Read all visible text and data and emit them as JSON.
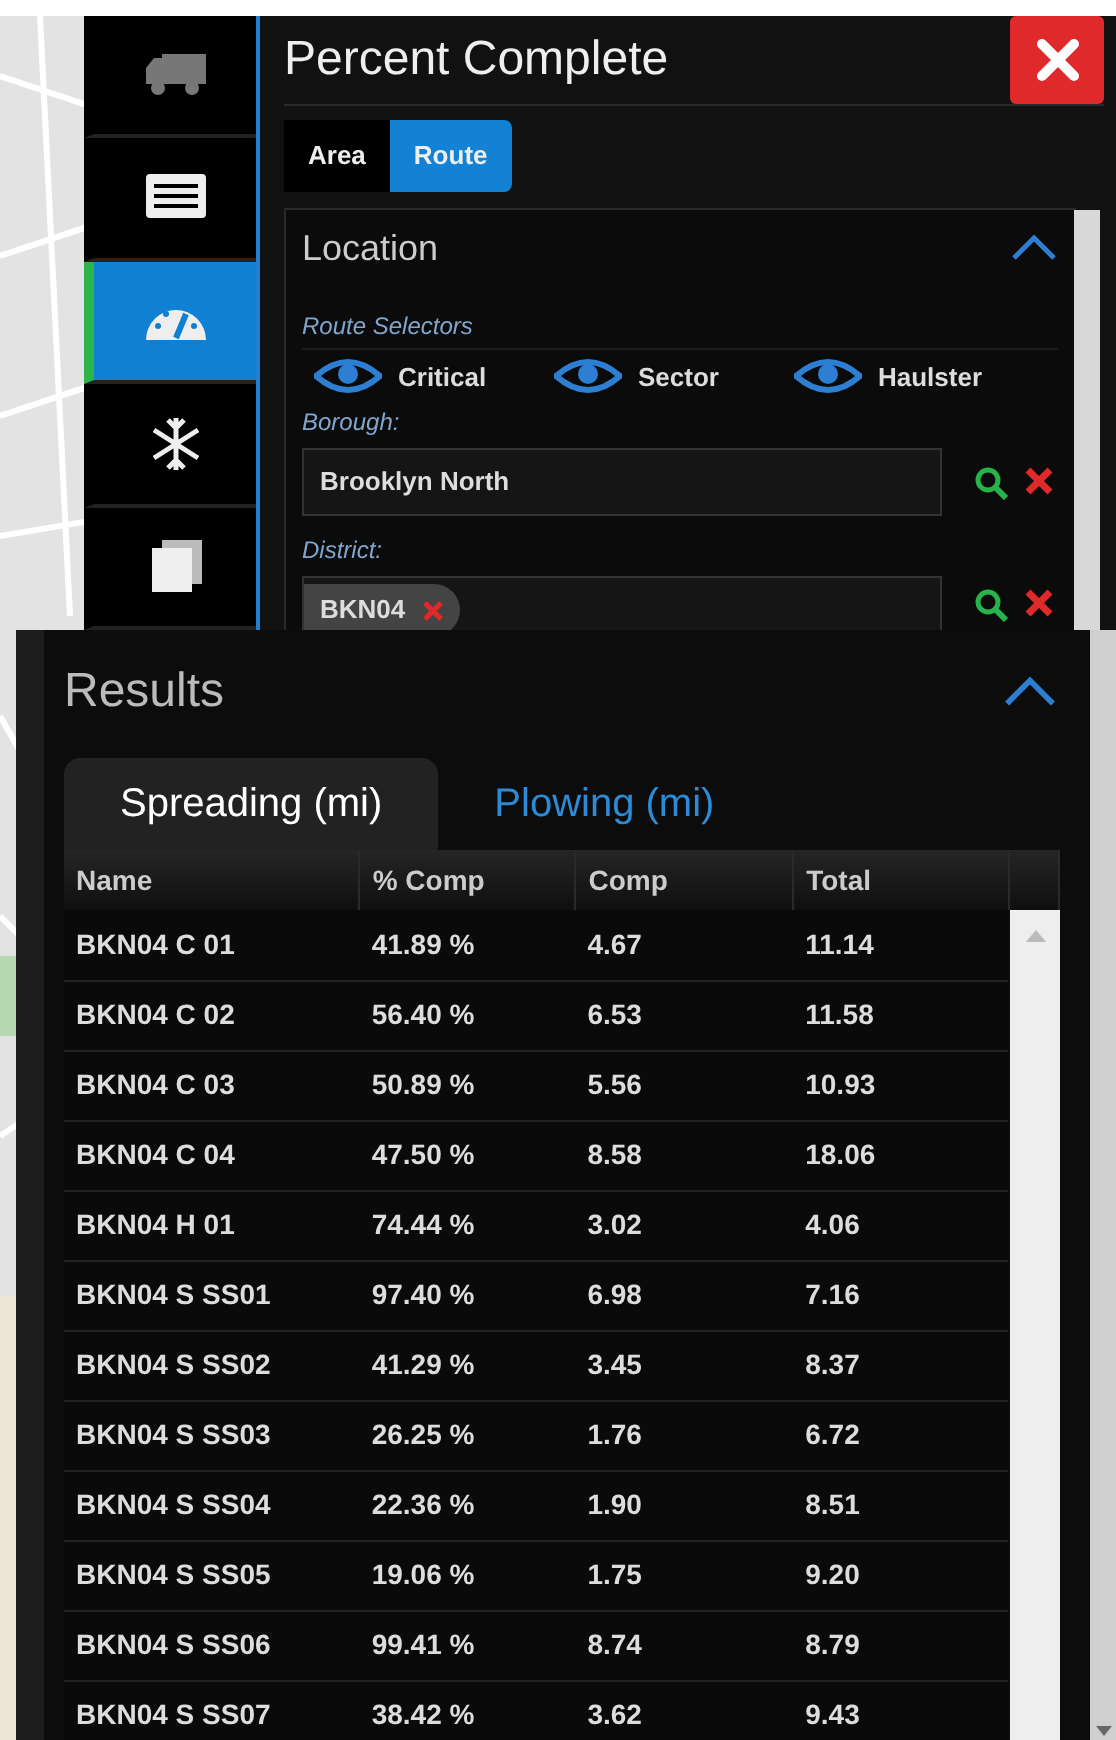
{
  "sidebar": {
    "items": [
      {
        "kind": "truck",
        "selected": false
      },
      {
        "kind": "list",
        "selected": false
      },
      {
        "kind": "gauge",
        "selected": true
      },
      {
        "kind": "snowflake",
        "selected": false
      },
      {
        "kind": "layers",
        "selected": false
      }
    ]
  },
  "window": {
    "title": "Percent Complete"
  },
  "tabs": [
    {
      "label": "Area",
      "selected": false
    },
    {
      "label": "Route",
      "selected": true
    }
  ],
  "location": {
    "title": "Location",
    "expanded": true,
    "selectors_label": "Route Selectors",
    "selectors": [
      {
        "label": "Critical"
      },
      {
        "label": "Sector"
      },
      {
        "label": "Haulster"
      }
    ],
    "borough": {
      "label": "Borough:",
      "value": "Brooklyn North"
    },
    "district": {
      "label": "District:",
      "chips": [
        "BKN04"
      ]
    }
  },
  "results": {
    "title": "Results",
    "expanded": true,
    "tabs": [
      {
        "label": "Spreading (mi)",
        "selected": true
      },
      {
        "label": "Plowing (mi)",
        "selected": false
      }
    ],
    "columns": [
      "Name",
      "% Comp",
      "Comp",
      "Total"
    ],
    "rows": [
      [
        "BKN04 C 01",
        "41.89 %",
        "4.67",
        "11.14"
      ],
      [
        "BKN04 C 02",
        "56.40 %",
        "6.53",
        "11.58"
      ],
      [
        "BKN04 C 03",
        "50.89 %",
        "5.56",
        "10.93"
      ],
      [
        "BKN04 C 04",
        "47.50 %",
        "8.58",
        "18.06"
      ],
      [
        "BKN04 H 01",
        "74.44 %",
        "3.02",
        "4.06"
      ],
      [
        "BKN04 S SS01",
        "97.40 %",
        "6.98",
        "7.16"
      ],
      [
        "BKN04 S SS02",
        "41.29 %",
        "3.45",
        "8.37"
      ],
      [
        "BKN04 S SS03",
        "26.25 %",
        "1.76",
        "6.72"
      ],
      [
        "BKN04 S SS04",
        "22.36 %",
        "1.90",
        "8.51"
      ],
      [
        "BKN04 S SS05",
        "19.06 %",
        "1.75",
        "9.20"
      ],
      [
        "BKN04 S SS06",
        "99.41 %",
        "8.74",
        "8.79"
      ],
      [
        "BKN04 S SS07",
        "38.42 %",
        "3.62",
        "9.43"
      ]
    ]
  }
}
